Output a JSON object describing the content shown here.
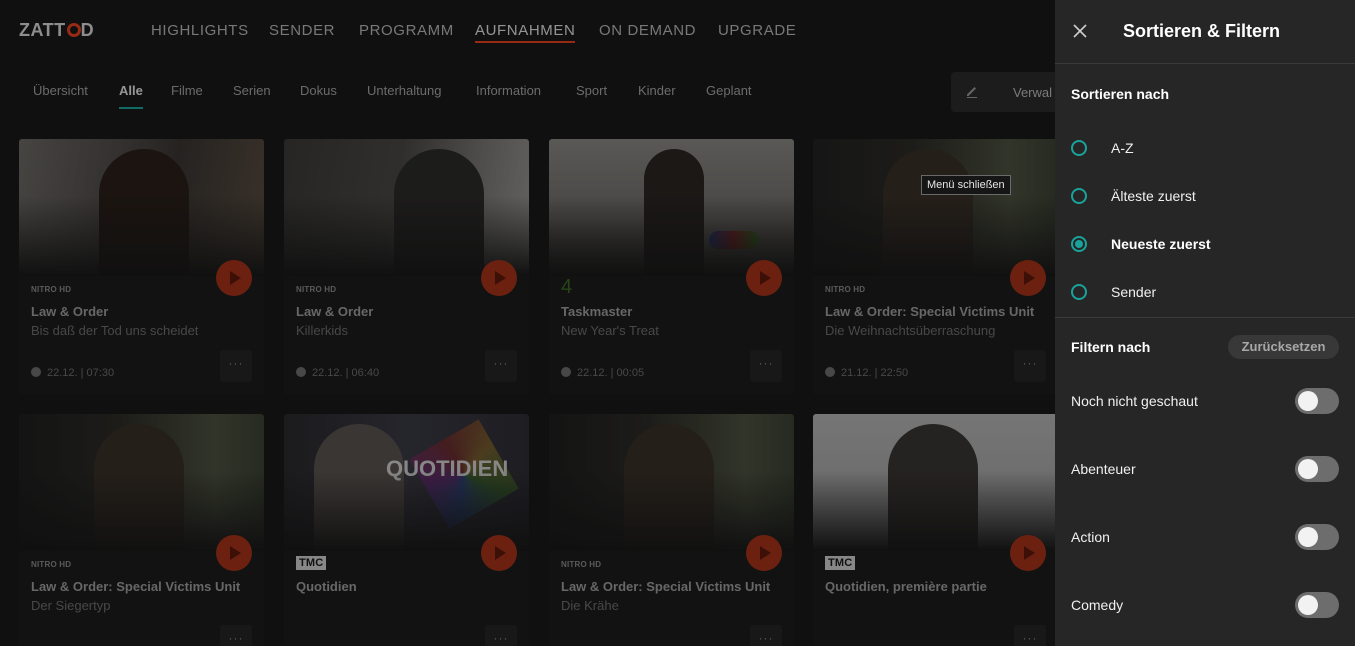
{
  "logo": {
    "text_pre": "ZATT",
    "text_post": "D"
  },
  "nav": [
    {
      "label": "HIGHLIGHTS"
    },
    {
      "label": "SENDER"
    },
    {
      "label": "PROGRAMM"
    },
    {
      "label": "AUFNAHMEN",
      "active": true
    },
    {
      "label": "ON DEMAND"
    },
    {
      "label": "UPGRADE"
    }
  ],
  "subnav": [
    {
      "label": "Übersicht"
    },
    {
      "label": "Alle",
      "active": true
    },
    {
      "label": "Filme"
    },
    {
      "label": "Serien"
    },
    {
      "label": "Dokus"
    },
    {
      "label": "Unterhaltung"
    },
    {
      "label": "Information"
    },
    {
      "label": "Sport"
    },
    {
      "label": "Kinder"
    },
    {
      "label": "Geplant"
    }
  ],
  "manage_label": "Verwal",
  "cards": [
    {
      "channel": "NITRO HD",
      "title": "Law & Order",
      "subtitle": "Bis daß der Tod uns scheidet",
      "date": "22.12. | 07:30"
    },
    {
      "channel": "NITRO HD",
      "title": "Law & Order",
      "subtitle": "Killerkids",
      "date": "22.12. | 06:40"
    },
    {
      "channel": "4",
      "title": "Taskmaster",
      "subtitle": "New Year's Treat",
      "date": "22.12. | 00:05"
    },
    {
      "channel": "NITRO HD",
      "title": "Law & Order: Special Victims Unit",
      "subtitle": "Die Weihnachtsüberraschung",
      "date": "21.12. | 22:50"
    },
    {
      "channel": "NITRO HD",
      "title": "Law & Order: Special Victims Unit",
      "subtitle": "Der Siegertyp",
      "date": ""
    },
    {
      "channel": "TMC",
      "title": "Quotidien",
      "subtitle": "",
      "date": ""
    },
    {
      "channel": "NITRO HD",
      "title": "Law & Order: Special Victims Unit",
      "subtitle": "Die Krähe",
      "date": ""
    },
    {
      "channel": "TMC",
      "title": "Quotidien, première partie",
      "subtitle": "",
      "date": ""
    }
  ],
  "thumb_overlay_text": "QUOTIDIEN",
  "more_label": "···",
  "tooltip": "Menü schließen",
  "panel": {
    "title": "Sortieren & Filtern",
    "sort_title": "Sortieren nach",
    "sort_options": [
      {
        "label": "A-Z",
        "selected": false
      },
      {
        "label": "Älteste zuerst",
        "selected": false
      },
      {
        "label": "Neueste zuerst",
        "selected": true
      },
      {
        "label": "Sender",
        "selected": false
      }
    ],
    "filter_title": "Filtern nach",
    "reset_label": "Zurücksetzen",
    "filters": [
      {
        "label": "Noch nicht geschaut",
        "on": false
      },
      {
        "label": "Abenteuer",
        "on": false
      },
      {
        "label": "Action",
        "on": false
      },
      {
        "label": "Comedy",
        "on": false
      }
    ]
  },
  "colors": {
    "accent_teal": "#19a39b",
    "brand_orange": "#e8411c",
    "panel_bg": "#262626"
  }
}
